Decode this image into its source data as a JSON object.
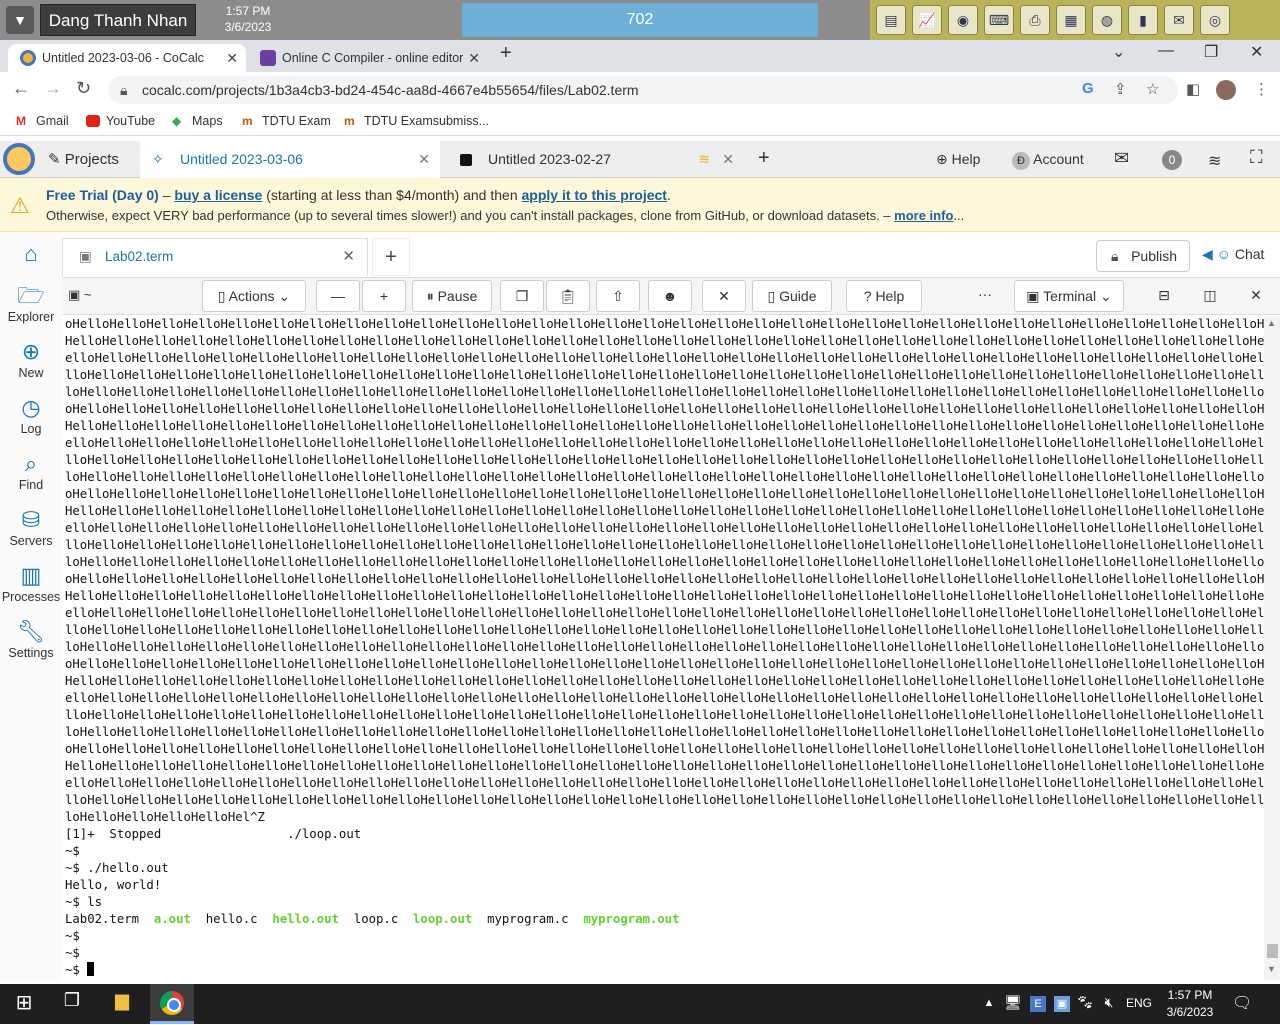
{
  "desktop": {
    "user_name": "Dang Thanh Nhan",
    "time": "1:57 PM",
    "date": "3/6/2023",
    "counter": "702"
  },
  "browser": {
    "tabs": [
      {
        "label": "Untitled 2023-03-06 - CoCalc",
        "active": true
      },
      {
        "label": "Online C Compiler - online editor",
        "active": false
      }
    ],
    "url": "cocalc.com/projects/1b3a4cb3-bd24-454c-aa8d-4667e4b55654/files/Lab02.term",
    "bookmarks": [
      "Gmail",
      "YouTube",
      "Maps",
      "TDTU Exam",
      "TDTU Examsubmiss..."
    ]
  },
  "cocalc": {
    "projects_label": "Projects",
    "project_tabs": [
      {
        "label": "Untitled 2023-03-06",
        "active": true
      },
      {
        "label": "Untitled 2023-02-27",
        "active": false
      }
    ],
    "help_label": "Help",
    "account_label": "Account",
    "notification_count": "0"
  },
  "banner": {
    "trial": "Free Trial (Day 0)",
    "dash": " – ",
    "buy_license": "buy a license",
    "mid": " (starting at less than $4/month) and then ",
    "apply": "apply it to this project",
    "period": ".",
    "line2": "Otherwise, expect VERY bad performance (up to several times slower!) and you can't install packages, clone from GitHub, or download datasets. – ",
    "more_info": "more info",
    "ellipsis": "..."
  },
  "sidebar": {
    "items": [
      {
        "label": "Explorer"
      },
      {
        "label": "New"
      },
      {
        "label": "Log"
      },
      {
        "label": "Find"
      },
      {
        "label": "Servers"
      },
      {
        "label": "Processes"
      },
      {
        "label": "Settings"
      }
    ]
  },
  "editor": {
    "file_tab": "Lab02.term",
    "publish": "Publish",
    "chat": "Chat"
  },
  "toolbar": {
    "path": "~",
    "actions": "Actions",
    "pause": "Pause",
    "guide": "Guide",
    "help": "Help",
    "more": "···",
    "terminal": "Terminal"
  },
  "terminal": {
    "hello_lines": [
      "oHelloHelloHelloHelloHelloHelloHelloHelloHelloHelloHelloHelloHelloHelloHelloHelloHelloHelloHelloHelloHelloHelloHelloHelloHelloHelloHelloHelloHelloHelloHelloHelloHelloHelloHello",
      "HelloHelloHelloHelloHelloHelloHelloHelloHelloHelloHelloHelloHelloHelloHelloHelloHelloHelloHelloHelloHelloHelloHelloHelloHelloHelloHelloHelloHelloHelloHelloHelloHelloHelloHelloH",
      "elloHelloHelloHelloHelloHelloHelloHelloHelloHelloHelloHelloHelloHelloHelloHelloHelloHelloHelloHelloHelloHelloHelloHelloHelloHelloHelloHelloHelloHelloHelloHelloHelloHelloHelloHe",
      "lloHelloHelloHelloHelloHelloHelloHelloHelloHelloHelloHelloHelloHelloHelloHelloHelloHelloHelloHelloHelloHelloHelloHelloHelloHelloHelloHelloHelloHelloHelloHelloHelloHelloHelloHel",
      "loHelloHelloHelloHelloHelloHelloHelloHelloHelloHelloHelloHelloHelloHelloHelloHelloHelloHelloHelloHelloHelloHelloHelloHelloHelloHelloHelloHelloHelloHelloHelloHelloHelloHelloHell",
      "oHelloHelloHelloHelloHelloHelloHelloHelloHelloHelloHelloHelloHelloHelloHelloHelloHelloHelloHelloHelloHelloHelloHelloHelloHelloHelloHelloHelloHelloHelloHelloHelloHelloHelloHello",
      "HelloHelloHelloHelloHelloHelloHelloHelloHelloHelloHelloHelloHelloHelloHelloHelloHelloHelloHelloHelloHelloHelloHelloHelloHelloHelloHelloHelloHelloHelloHelloHelloHelloHelloHelloH",
      "elloHelloHelloHelloHelloHelloHelloHelloHelloHelloHelloHelloHelloHelloHelloHelloHelloHelloHelloHelloHelloHelloHelloHelloHelloHelloHelloHelloHelloHelloHelloHelloHelloHelloHelloHe",
      "lloHelloHelloHelloHelloHelloHelloHelloHelloHelloHelloHelloHelloHelloHelloHelloHelloHelloHelloHelloHelloHelloHelloHelloHelloHelloHelloHelloHelloHelloHelloHelloHelloHelloHelloHel",
      "loHelloHelloHelloHelloHelloHelloHelloHelloHelloHelloHelloHelloHelloHelloHelloHelloHelloHelloHelloHelloHelloHelloHelloHelloHelloHelloHelloHelloHelloHelloHelloHelloHelloHelloHell",
      "oHelloHelloHelloHelloHelloHelloHelloHelloHelloHelloHelloHelloHelloHelloHelloHelloHelloHelloHelloHelloHelloHelloHelloHelloHelloHelloHelloHelloHelloHelloHelloHelloHelloHelloHello",
      "HelloHelloHelloHelloHelloHelloHelloHelloHelloHelloHelloHelloHelloHelloHelloHelloHelloHelloHelloHelloHelloHelloHelloHelloHelloHelloHelloHelloHelloHelloHelloHelloHelloHelloHelloH",
      "elloHelloHelloHelloHelloHelloHelloHelloHelloHelloHelloHelloHelloHelloHelloHelloHelloHelloHelloHelloHelloHelloHelloHelloHelloHelloHelloHelloHelloHelloHelloHelloHelloHelloHelloHe",
      "lloHelloHelloHelloHelloHelloHelloHelloHelloHelloHelloHelloHelloHelloHelloHelloHelloHelloHelloHelloHelloHelloHelloHelloHelloHelloHelloHelloHelloHelloHelloHelloHelloHelloHelloHel",
      "loHelloHelloHelloHelloHelloHelloHelloHelloHelloHelloHelloHelloHelloHelloHelloHelloHelloHelloHelloHelloHelloHelloHelloHelloHelloHelloHelloHelloHelloHelloHelloHelloHelloHelloHell",
      "oHelloHelloHelloHelloHelloHelloHelloHelloHelloHelloHelloHelloHelloHelloHelloHelloHelloHelloHelloHelloHelloHelloHelloHelloHelloHelloHelloHelloHelloHelloHelloHelloHelloHelloHello",
      "HelloHelloHelloHelloHelloHelloHelloHelloHelloHelloHelloHelloHelloHelloHelloHelloHelloHelloHelloHelloHelloHelloHelloHelloHelloHelloHelloHelloHelloHelloHelloHelloHelloHelloHelloH",
      "elloHelloHelloHelloHelloHelloHelloHelloHelloHelloHelloHelloHelloHelloHelloHelloHelloHelloHelloHelloHelloHelloHelloHelloHelloHelloHelloHelloHelloHelloHelloHelloHelloHelloHelloHe",
      "lloHelloHelloHelloHelloHelloHelloHelloHelloHelloHelloHelloHelloHelloHelloHelloHelloHelloHelloHelloHelloHelloHelloHelloHelloHelloHelloHelloHelloHelloHelloHelloHelloHelloHelloHel",
      "loHelloHelloHelloHelloHelloHelloHelloHelloHelloHelloHelloHelloHelloHelloHelloHelloHelloHelloHelloHelloHelloHelloHelloHelloHelloHelloHelloHelloHelloHelloHelloHelloHelloHelloHell",
      "oHelloHelloHelloHelloHelloHelloHelloHelloHelloHelloHelloHelloHelloHelloHelloHelloHelloHelloHelloHelloHelloHelloHelloHelloHelloHelloHelloHelloHelloHelloHelloHelloHelloHelloHello",
      "HelloHelloHelloHelloHelloHelloHelloHelloHelloHelloHelloHelloHelloHelloHelloHelloHelloHelloHelloHelloHelloHelloHelloHelloHelloHelloHelloHelloHelloHelloHelloHelloHelloHelloHelloH",
      "elloHelloHelloHelloHelloHelloHelloHelloHelloHelloHelloHelloHelloHelloHelloHelloHelloHelloHelloHelloHelloHelloHelloHelloHelloHelloHelloHelloHelloHelloHelloHelloHelloHelloHelloHe",
      "lloHelloHelloHelloHelloHelloHelloHelloHelloHelloHelloHelloHelloHelloHelloHelloHelloHelloHelloHelloHelloHelloHelloHelloHelloHelloHelloHelloHelloHelloHelloHelloHelloHelloHelloHel",
      "loHelloHelloHelloHelloHelloHelloHelloHelloHelloHelloHelloHelloHelloHelloHelloHelloHelloHelloHelloHelloHelloHelloHelloHelloHelloHelloHelloHelloHelloHelloHelloHelloHelloHelloHell",
      "oHelloHelloHelloHelloHelloHelloHelloHelloHelloHelloHelloHelloHelloHelloHelloHelloHelloHelloHelloHelloHelloHelloHelloHelloHelloHelloHelloHelloHelloHelloHelloHelloHelloHelloHello",
      "HelloHelloHelloHelloHelloHelloHelloHelloHelloHelloHelloHelloHelloHelloHelloHelloHelloHelloHelloHelloHelloHelloHelloHelloHelloHelloHelloHelloHelloHelloHelloHelloHelloHelloHelloH",
      "elloHelloHelloHelloHelloHelloHelloHelloHelloHelloHelloHelloHelloHelloHelloHelloHelloHelloHelloHelloHelloHelloHelloHelloHelloHelloHelloHelloHelloHelloHelloHelloHelloHelloHelloHe",
      "lloHelloHelloHelloHelloHelloHelloHelloHelloHelloHelloHelloHelloHelloHelloHelloHelloHelloHelloHelloHelloHelloHelloHelloHelloHelloHelloHelloHelloHelloHelloHelloHelloHelloHelloHel",
      "loHelloHelloHelloHelloHel^Z"
    ],
    "stopped_line": "[1]+  Stopped                 ./loop.out",
    "prompt_empty": "~$",
    "cmd_hello": "~$ ./hello.out",
    "hello_output": "Hello, world!",
    "cmd_ls": "~$ ls",
    "ls_output": [
      {
        "name": "Lab02.term",
        "exec": false
      },
      {
        "name": "a.out",
        "exec": true
      },
      {
        "name": "hello.c",
        "exec": false
      },
      {
        "name": "hello.out",
        "exec": true
      },
      {
        "name": "loop.c",
        "exec": false
      },
      {
        "name": "loop.out",
        "exec": true
      },
      {
        "name": "myprogram.c",
        "exec": false
      },
      {
        "name": "myprogram.out",
        "exec": true
      }
    ],
    "exec_color": "#62d22e"
  },
  "taskbar": {
    "language": "ENG",
    "time": "1:57 PM",
    "date": "3/6/2023"
  }
}
